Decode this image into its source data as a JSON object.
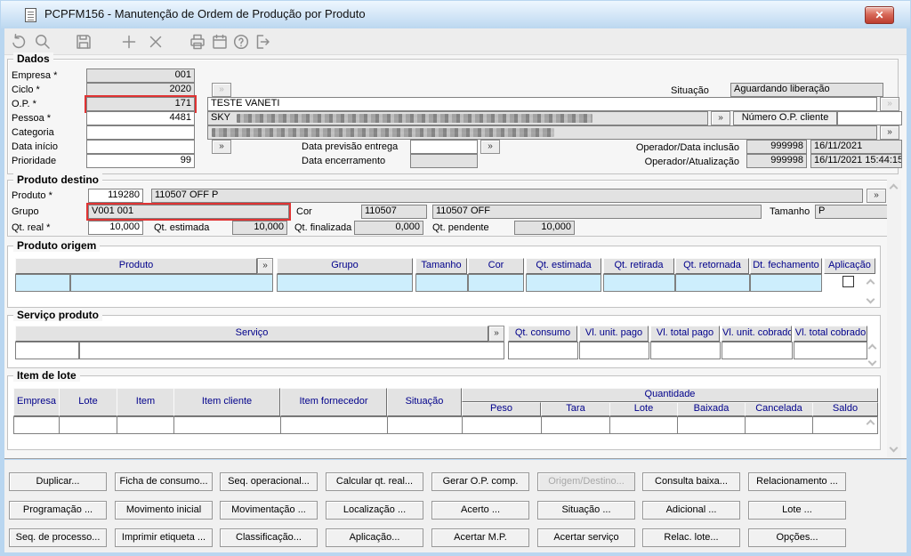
{
  "window": {
    "title": "PCPFM156 - Manutenção de Ordem de Produção por Produto",
    "close_glyph": "✕"
  },
  "toolbar": {
    "icons": [
      "undo",
      "search",
      "save",
      "add",
      "delete",
      "print",
      "calendar",
      "help",
      "exit"
    ]
  },
  "colors": {
    "validation_red": "#e03333",
    "table_header_text": "#00008b",
    "table_row_blue": "#cdeefd",
    "titlebar_blue": "#cbe1f5"
  },
  "more_glyph": "»",
  "dados": {
    "legend": "Dados",
    "empresa_label": "Empresa *",
    "empresa_value": "001",
    "ciclo_label": "Ciclo *",
    "ciclo_value": "2020",
    "op_label": "O.P. *",
    "op_value": "171",
    "op_desc": "TESTE VANETI",
    "situacao_label": "Situação",
    "situacao_value": "Aguardando liberação",
    "pessoa_label": "Pessoa *",
    "pessoa_value": "4481",
    "pessoa_desc_prefix": "SKY",
    "numero_op_cliente_label": "Número O.P. cliente",
    "numero_op_cliente_value": "",
    "categoria_label": "Categoria",
    "categoria_value": "",
    "data_inicio_label": "Data início",
    "data_inicio_value": "",
    "prioridade_label": "Prioridade",
    "prioridade_value": "99",
    "data_previsao_label": "Data previsão entrega",
    "data_previsao_value": "",
    "data_encerramento_label": "Data encerramento",
    "data_encerramento_value": "",
    "operador_inclusao_label": "Operador/Data inclusão",
    "operador_inclusao_id": "999998",
    "operador_inclusao_date": "16/11/2021",
    "operador_atualizacao_label": "Operador/Atualização",
    "operador_atualizacao_id": "999998",
    "operador_atualizacao_date": "16/11/2021 15:44:15"
  },
  "produto_destino": {
    "legend": "Produto destino",
    "produto_label": "Produto *",
    "produto_value": "119280",
    "produto_desc": "110507 OFF P",
    "grupo_label": "Grupo",
    "grupo_value": "V001 001",
    "cor_label": "Cor",
    "cor_value": "110507",
    "cor_desc": "110507 OFF",
    "tamanho_label": "Tamanho",
    "tamanho_value": "P",
    "qt_real_label": "Qt. real *",
    "qt_real_value": "10,000",
    "qt_estimada_label": "Qt. estimada",
    "qt_estimada_value": "10,000",
    "qt_finalizada_label": "Qt. finalizada",
    "qt_finalizada_value": "0,000",
    "qt_pendente_label": "Qt. pendente",
    "qt_pendente_value": "10,000"
  },
  "produto_origem": {
    "legend": "Produto origem",
    "columns": [
      "Produto",
      "Grupo",
      "Tamanho",
      "Cor",
      "Qt. estimada",
      "Qt. retirada",
      "Qt. retornada",
      "Dt. fechamento",
      "Aplicação"
    ]
  },
  "servico_produto": {
    "legend": "Serviço produto",
    "columns": [
      "Serviço",
      "Qt. consumo",
      "Vl. unit. pago",
      "Vl. total pago",
      "Vl. unit. cobrado",
      "Vl. total cobrado"
    ]
  },
  "item_lote": {
    "legend": "Item de lote",
    "columns": [
      "Empresa",
      "Lote",
      "Item",
      "Item cliente",
      "Item fornecedor",
      "Situação"
    ],
    "quantidade_label": "Quantidade",
    "quantidade_columns": [
      "Peso",
      "Tara",
      "Lote",
      "Baixada",
      "Cancelada",
      "Saldo"
    ]
  },
  "buttons": {
    "row1": [
      "Duplicar...",
      "Ficha de consumo...",
      "Seq. operacional...",
      "Calcular qt. real...",
      "Gerar O.P. comp.",
      "Origem/Destino...",
      "Consulta baixa...",
      "Relacionamento ..."
    ],
    "row2": [
      "Programação ...",
      "Movimento inicial",
      "Movimentação ...",
      "Localização ...",
      "Acerto ...",
      "Situação ...",
      "Adicional ...",
      "Lote ..."
    ],
    "row3": [
      "Seq. de processo...",
      "Imprimir etiqueta ...",
      "Classificação...",
      "Aplicação...",
      "Acertar M.P.",
      "Acertar serviço",
      "Relac. lote...",
      "Opções..."
    ]
  }
}
